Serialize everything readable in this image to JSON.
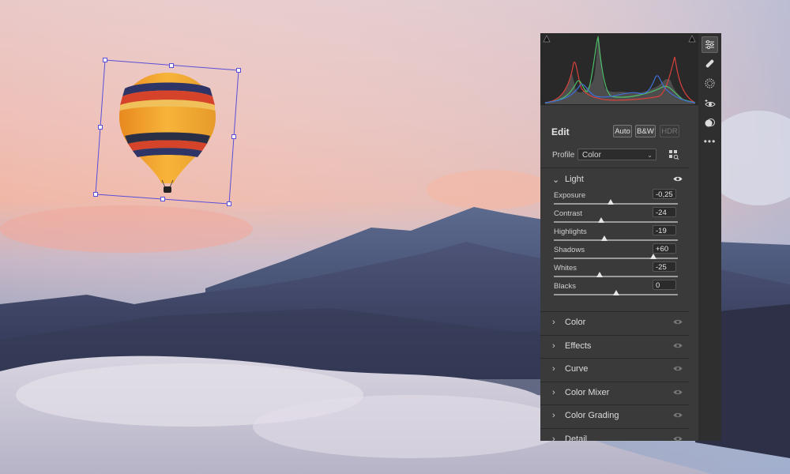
{
  "histogram": {
    "clipping_left_icon": "shadow-clip-icon",
    "clipping_right_icon": "highlight-clip-icon",
    "colors": {
      "red": "#d9413b",
      "green": "#4fbf6a",
      "blue": "#3e6fd8",
      "gray": "#9a9a9a"
    }
  },
  "edit": {
    "title": "Edit",
    "auto_label": "Auto",
    "bw_label": "B&W",
    "hdr_label": "HDR"
  },
  "profile": {
    "label": "Profile",
    "value": "Color",
    "browse_icon": "profile-browser-grid-icon"
  },
  "light": {
    "label": "Light",
    "sliders": [
      {
        "label": "Exposure",
        "value": "-0,25",
        "position": 0.46
      },
      {
        "label": "Contrast",
        "value": "-24",
        "position": 0.38
      },
      {
        "label": "Highlights",
        "value": "-19",
        "position": 0.41
      },
      {
        "label": "Shadows",
        "value": "+60",
        "position": 0.8
      },
      {
        "label": "Whites",
        "value": "-25",
        "position": 0.37
      },
      {
        "label": "Blacks",
        "value": "0",
        "position": 0.5
      }
    ]
  },
  "sections": [
    {
      "label": "Color"
    },
    {
      "label": "Effects"
    },
    {
      "label": "Curve"
    },
    {
      "label": "Color Mixer"
    },
    {
      "label": "Color Grading"
    },
    {
      "label": "Detail"
    }
  ],
  "tools": [
    {
      "name": "edit-sliders-icon",
      "active": true
    },
    {
      "name": "healing-icon",
      "active": false
    },
    {
      "name": "masking-icon",
      "active": false
    },
    {
      "name": "red-eye-icon",
      "active": false
    },
    {
      "name": "presets-icon",
      "active": false
    },
    {
      "name": "more-icon",
      "active": false
    }
  ],
  "accent": "#5a4fd6"
}
